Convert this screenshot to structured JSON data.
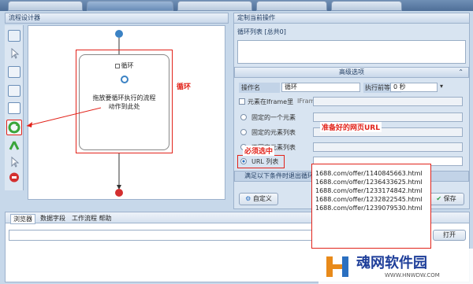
{
  "flow_designer": {
    "title": "流程设计器",
    "loop_node": {
      "label": "循环",
      "hint": "拖放要循环执行的流程动作到此处"
    }
  },
  "annotations": {
    "loop_label": "循环",
    "url_list_label": "准备好的网页URL",
    "must_select": "必须选中"
  },
  "right_panel": {
    "title": "定制当前操作",
    "subheader": "循环列表 [总共0]",
    "advanced": "高级选项",
    "op_name_label": "操作名",
    "op_name_value": "循环",
    "wait_label": "执行前等待",
    "wait_value": "0 秒",
    "iframe_label": "元素在Iframe里",
    "iframe_xpath_label": "IFrameXPath",
    "radio_single": "固定的一个元素",
    "radio_fixed_list": "固定的元素列表",
    "radio_variable_list": "不固定元素列表",
    "radio_url_list": "URL 列表",
    "exit_condition": "满足以下条件时退出循环",
    "define_btn": "自定义",
    "save_btn": "保存"
  },
  "url_list": [
    "1688.com/offer/1140845663.html",
    "1688.com/offer/1236433625.html",
    "1688.com/offer/1233174842.html",
    "1688.com/offer/1232822545.html",
    "1688.com/offer/1239079530.html"
  ],
  "bottom_tabs": [
    "浏览器",
    "数据字段",
    "工作流程 帮助"
  ],
  "open_btn": "打开",
  "watermark": {
    "brand": "魂网软件园",
    "url": "WWW.HNWDW.COM"
  }
}
